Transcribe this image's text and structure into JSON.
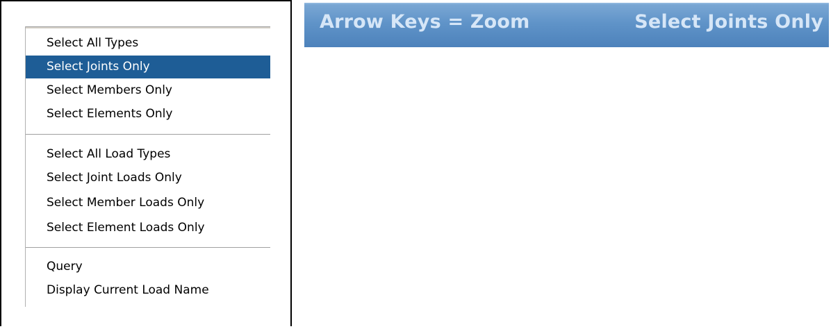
{
  "menu": {
    "group1": [
      {
        "label": "Select All Types",
        "selected": false
      },
      {
        "label": "Select Joints Only",
        "selected": true
      },
      {
        "label": "Select Members Only",
        "selected": false
      },
      {
        "label": "Select Elements Only",
        "selected": false
      }
    ],
    "group2": [
      {
        "label": "Select All Load Types",
        "selected": false
      },
      {
        "label": "Select Joint Loads Only",
        "selected": false
      },
      {
        "label": "Select Member Loads Only",
        "selected": false
      },
      {
        "label": "Select Element Loads Only",
        "selected": false
      }
    ],
    "group3": [
      {
        "label": "Query",
        "selected": false
      },
      {
        "label": "Display Current Load Name",
        "selected": false
      }
    ],
    "selected_color": "#1e5d96"
  },
  "status_bar": {
    "left_text": "Arrow Keys = Zoom",
    "right_text": "Select Joints Only",
    "color": "#5f93c8"
  }
}
